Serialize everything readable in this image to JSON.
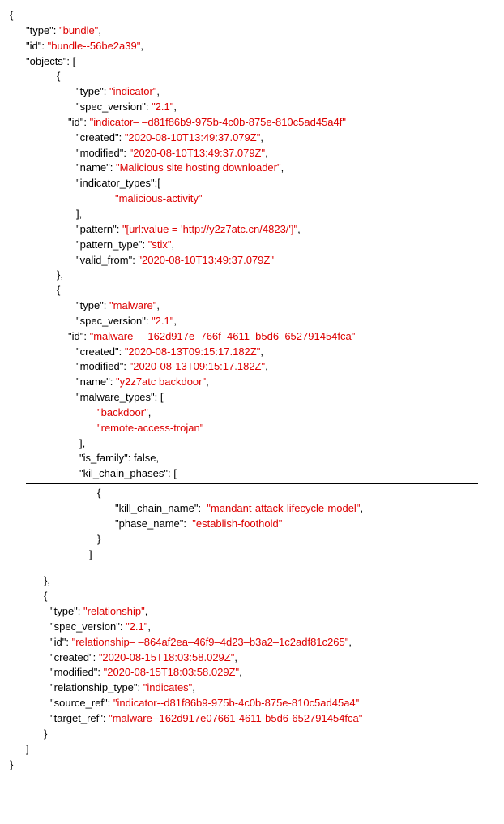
{
  "lcurl": "{",
  "rcurl": "}",
  "rcurl_comma": "},",
  "lbrack": "[",
  "rbrack": "]",
  "rbrack_comma": "],",
  "bundle": {
    "k_type": "\"type\":",
    "v_type": " \"bundle\"",
    "k_id": "\"id\":",
    "v_id": " \"bundle--56be2a39\"",
    "k_objects": "\"objects\": [",
    "close_objects": "]"
  },
  "indicator": {
    "k_type": "\"type\":",
    "v_type": " \"indicator\"",
    "k_spec": "\"spec_version\":",
    "v_spec": " \"2.1\"",
    "k_id": "\"id\":",
    "v_id": " \"indicator– –d81f86b9-975b-4c0b-875e-810c5ad45a4f\"",
    "k_created": "\"created\":",
    "v_created": " \"2020-08-10T13:49:37.079Z\"",
    "k_modified": "\"modified\":",
    "v_modified": " \"2020-08-10T13:49:37.079Z\"",
    "k_name": "\"name\":",
    "v_name": " \"Malicious site hosting downloader\"",
    "k_itypes": "\"indicator_types\":[",
    "v_itypes": "\"malicious-activity\"",
    "k_pattern": "\"pattern\":",
    "v_pattern": " \"[url:value = 'http://y2z7atc.cn/4823/']\"",
    "k_ptype": "\"pattern_type\":",
    "v_ptype": " \"stix\"",
    "k_valid": "\"valid_from\":",
    "v_valid": " \"2020-08-10T13:49:37.079Z\""
  },
  "malware": {
    "k_type": "\"type\":",
    "v_type": " \"malware\"",
    "k_spec": "\"spec_version\":",
    "v_spec": " \"2.1\"",
    "k_id": "\"id\":",
    "v_id": " \"malware– –162d917e–766f–4611–b5d6–652791454fca\"",
    "k_created": "\"created\":",
    "v_created": " \"2020-08-13T09:15:17.182Z\"",
    "k_modified": "\"modified\":",
    "v_modified": " \"2020-08-13T09:15:17.182Z\"",
    "k_name": "\"name\":",
    "v_name": " \"y2z7atc backdoor\"",
    "k_mtypes": "\"malware_types\": [",
    "v_backdoor": "\"backdoor\"",
    "v_rat": "\"remote-access-trojan\"",
    "k_isfam": "\"is_family\": false,",
    "k_kcp": "\"kil_chain_phases\": [",
    "k_kcn": "\"kill_chain_name\":",
    "v_kcn": "  \"mandant-attack-lifecycle-model\"",
    "k_pn": "\"phase_name\":",
    "v_pn": "  \"establish-foothold\""
  },
  "rel": {
    "k_type": "\"type\":",
    "v_type": " \"relationship\"",
    "k_spec": "\"spec_version\":",
    "v_spec": " \"2.1\"",
    "k_id": "\"id\":",
    "v_id": " \"relationship– –864af2ea–46f9–4d23–b3a2–1c2adf81c265\"",
    "k_created": "\"created\":",
    "v_created": " \"2020-08-15T18:03:58.029Z\"",
    "k_modified": "\"modified\":",
    "v_modified": " \"2020-08-15T18:03:58.029Z\"",
    "k_rtype": "\"relationship_type\":",
    "v_rtype": " \"indicates\"",
    "k_src": "\"source_ref\":",
    "v_src": " \"indicator--d81f86b9-975b-4c0b-875e-810c5ad45a4\"",
    "k_tgt": "\"target_ref\":",
    "v_tgt": " \"malware--162d917e07661-4611-b5d6-652791454fca\""
  }
}
